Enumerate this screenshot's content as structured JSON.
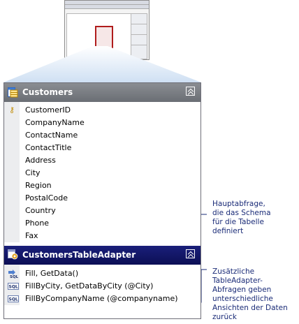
{
  "customers": {
    "title": "Customers",
    "columns": [
      "CustomerID",
      "CompanyName",
      "ContactName",
      "ContactTitle",
      "Address",
      "City",
      "Region",
      "PostalCode",
      "Country",
      "Phone",
      "Fax"
    ]
  },
  "adapter": {
    "title": "CustomersTableAdapter",
    "queries": [
      "Fill, GetData()",
      "FillByCity, GetDataByCity (@City)",
      "FillByCompanyName (@companyname)"
    ]
  },
  "callouts": {
    "main_query": "Hauptabfrage,\ndie das Schema\nfür die Tabelle\ndefiniert",
    "extra_queries": "Zusätzliche\nTableAdapter-\nAbfragen geben\nunterschiedliche\nAnsichten der Daten\nzurück"
  },
  "icons": {
    "table": "table-icon",
    "key": "primary-key-icon",
    "adapter": "tableadapter-icon",
    "sql": "sql-icon",
    "collapse": "collapse-chevron-icon"
  },
  "colors": {
    "table_header": "#7a7d83",
    "adapter_header": "#10146a",
    "callout_text": "#1a2b77",
    "thumb_selection": "#b01c1c"
  }
}
